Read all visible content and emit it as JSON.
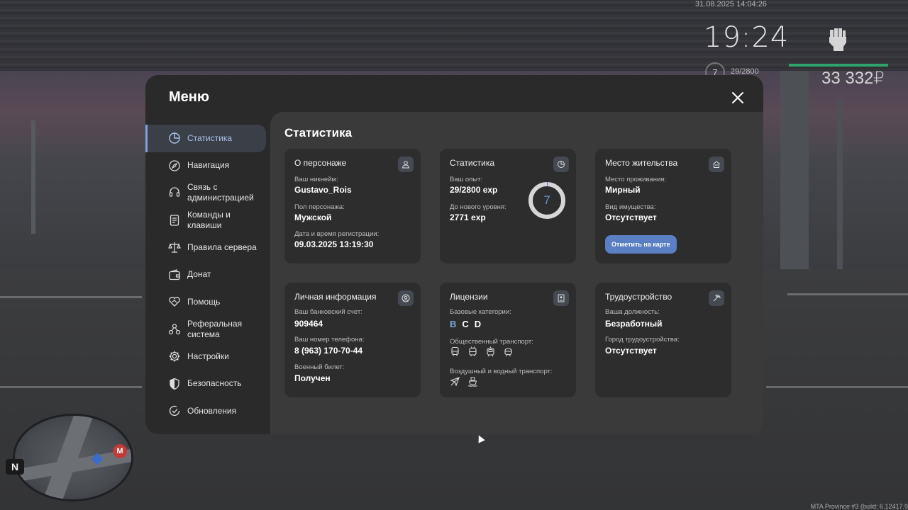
{
  "hud": {
    "datetime": "31.08.2025 14:04:26",
    "clock": "19:24",
    "level": "7",
    "exp": "29/2800",
    "money": "33 332₽",
    "minimap_north": "N",
    "minimap_metro": "M",
    "build_info": "MTA Province #3 (build: 6.12417.9"
  },
  "menu": {
    "title": "Меню",
    "sidebar": [
      {
        "label": "Статистика",
        "icon": "pie-chart-icon",
        "active": true
      },
      {
        "label": "Навигация",
        "icon": "compass-icon"
      },
      {
        "label": "Связь с администрацией",
        "line1": "Связь с",
        "line2": "администрацией",
        "icon": "headset-icon"
      },
      {
        "label": "Команды и клавиши",
        "line1": "Команды и",
        "line2": "клавиши",
        "icon": "document-icon"
      },
      {
        "label": "Правила сервера",
        "icon": "scales-icon"
      },
      {
        "label": "Донат",
        "icon": "wallet-icon"
      },
      {
        "label": "Помощь",
        "icon": "heart-handshake-icon"
      },
      {
        "label": "Реферальная система",
        "line1": "Реферальная",
        "line2": "система",
        "icon": "referral-nodes-icon"
      },
      {
        "label": "Настройки",
        "icon": "gear-icon"
      },
      {
        "label": "Безопасность",
        "icon": "shield-icon"
      },
      {
        "label": "Обновления",
        "icon": "check-circle-icon"
      }
    ]
  },
  "content": {
    "title": "Статистика",
    "character": {
      "title": "О персонаже",
      "nickname_label": "Ваш никнейм:",
      "nickname": "Gustavo_Rois",
      "gender_label": "Пол персонажа:",
      "gender": "Мужской",
      "reg_label": "Дата и время регистрации:",
      "reg": "09.03.2025 13:19:30"
    },
    "stats": {
      "title": "Статистика",
      "exp_label": "Ваш опыт:",
      "exp": "29/2800 exp",
      "next_label": "До нового уровня:",
      "next": "2771 exp",
      "level": "7",
      "progress_fraction": 0.0104
    },
    "residence": {
      "title": "Место жительства",
      "place_label": "Место проживания:",
      "place": "Мирный",
      "property_label": "Вид имущества:",
      "property": "Отсутствует",
      "map_button": "Отметить на карте"
    },
    "personal": {
      "title": "Личная информация",
      "bank_label": "Ваш банковский счет:",
      "bank": "909464",
      "phone_label": "Ваш номер телефона:",
      "phone": "8 (963) 170-70-44",
      "military_label": "Военный билет:",
      "military": "Получен"
    },
    "licenses": {
      "title": "Лицензии",
      "base_label": "Базовые категории:",
      "categories": [
        {
          "name": "B",
          "active": true
        },
        {
          "name": "C",
          "active": false
        },
        {
          "name": "D",
          "active": false
        }
      ],
      "public_label": "Общественный транспорт:",
      "public_icons": [
        "bus-icon",
        "trolleybus-icon",
        "tram-icon",
        "metro-icon"
      ],
      "air_label": "Воздушный и водный транспорт:",
      "air_icons": [
        "airplane-icon",
        "boat-icon"
      ]
    },
    "employment": {
      "title": "Трудоустройство",
      "position_label": "Ваша должность:",
      "position": "Безработный",
      "city_label": "Город трудоустройства:",
      "city": "Отсутствует"
    }
  },
  "colors": {
    "accent": "#7ea1e0",
    "button": "#5a7fc3",
    "hud_bar": "#2ea36a",
    "panel": "#2a2a2a",
    "content": "#3a3a3a",
    "card": "#2d2d2d"
  }
}
